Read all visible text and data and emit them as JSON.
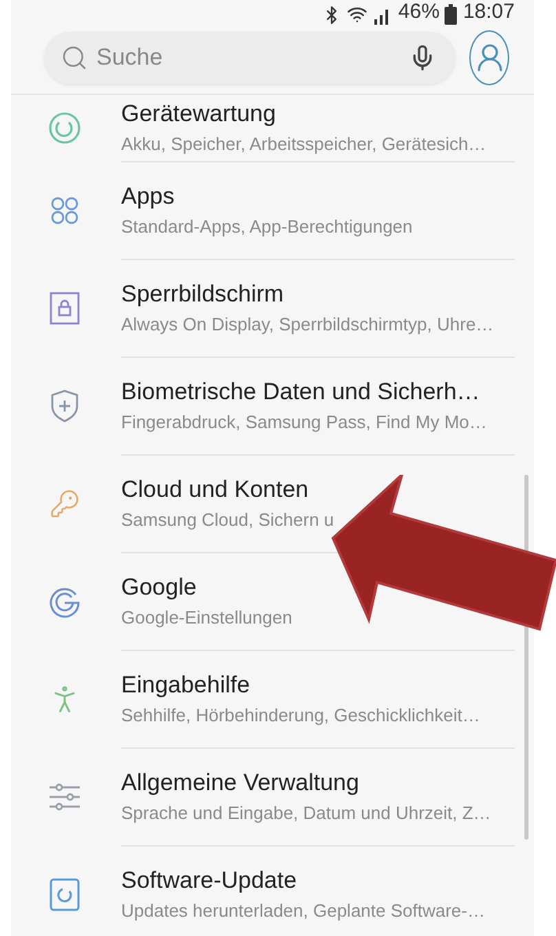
{
  "status_bar": {
    "battery": "46%",
    "time": "18:07"
  },
  "search": {
    "placeholder": "Suche"
  },
  "items": [
    {
      "kind": "maintenance",
      "title": "Gerätewartung",
      "subtitle": "Akku, Speicher, Arbeitsspeicher, Gerätesich…",
      "color": "#6cc4a8"
    },
    {
      "kind": "apps",
      "title": "Apps",
      "subtitle": "Standard-Apps, App-Berechtigungen",
      "color": "#6a9bd8"
    },
    {
      "kind": "lock",
      "title": "Sperrbildschirm",
      "subtitle": "Always On Display, Sperrbildschirmtyp, Uhre…",
      "color": "#8c84d0"
    },
    {
      "kind": "shield",
      "title": "Biometrische Daten und Sicherh…",
      "subtitle": "Fingerabdruck, Samsung Pass, Find My Mo…",
      "color": "#8a94a6"
    },
    {
      "kind": "key",
      "title": "Cloud und Konten",
      "subtitle": "Samsung Cloud, Sichern u",
      "color": "#e8a868"
    },
    {
      "kind": "google",
      "title": "Google",
      "subtitle": "Google-Einstellungen",
      "color": "#6a8fd0"
    },
    {
      "kind": "accessibility",
      "title": "Eingabehilfe",
      "subtitle": "Sehhilfe, Hörbehinderung, Geschicklichkeit…",
      "color": "#7cc486"
    },
    {
      "kind": "sliders",
      "title": "Allgemeine Verwaltung",
      "subtitle": "Sprache und Eingabe, Datum und Uhrzeit, Z…",
      "color": "#9aa0a8"
    },
    {
      "kind": "update",
      "title": "Software-Update",
      "subtitle": "Updates herunterladen, Geplante Software-…",
      "color": "#5a9ad8"
    }
  ]
}
